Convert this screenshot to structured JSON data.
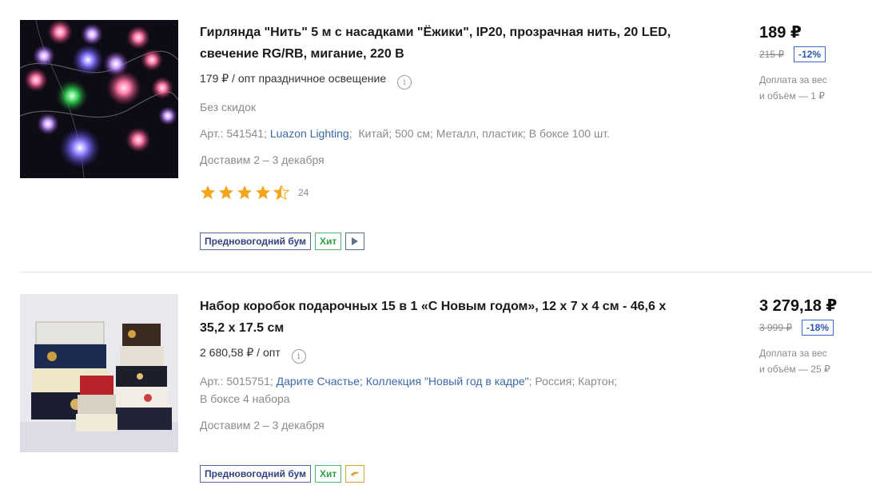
{
  "products": [
    {
      "title_line1": "Гирлянда \"Нить\" 5 м с насадками \"Ёжики\", IP20, прозрачная нить, 20 LED,",
      "title_line2": "свечение RG/RB, мигание, 220 В",
      "wholesale": "179 ₽ / опт праздничное освещение",
      "info_icon": "i",
      "discount_note": "Без скидок",
      "article": "Арт.: 541541;",
      "brand": "Luazon Lighting",
      "specs": "Китай; 500 см; Металл, пластик; В боксе 100 шт.",
      "delivery": "Доставим 2 – 3 декабря",
      "rating": 4.5,
      "rating_count": "24",
      "badges": [
        "Предновогодний бум",
        "Хит"
      ],
      "badge_icon": "play-icon",
      "price": "189 ₽",
      "old_price": "215 ₽",
      "discount": "-12%",
      "surcharge_line1": "Доплата за вес",
      "surcharge_line2": "и объём — 1 ₽"
    },
    {
      "title_line1": "Набор коробок подарочных 15 в 1 «С Новым годом», 12 х 7 х 4 см - 46,6 х",
      "title_line2": "35,2 х 17.5 см",
      "wholesale": "2 680,58 ₽ / опт",
      "info_icon": "i",
      "article": "Арт.: 5015751;",
      "brand": "Дарите Счастье;",
      "collection": "Коллекция \"Новый год в кадре\"",
      "specs_line1_rest": "; Россия; Картон;",
      "specs_line2": "В боксе 4 набора",
      "delivery": "Доставим 2 – 3 декабря",
      "badges": [
        "Предновогодний бум",
        "Хит"
      ],
      "badge_icon": "dolphin-icon",
      "price": "3 279,18 ₽",
      "old_price": "3 999 ₽",
      "discount": "-18%",
      "surcharge_line1": "Доплата за вес",
      "surcharge_line2": "и объём — 25 ₽"
    }
  ],
  "colors": {
    "link": "#3b69a8",
    "badge_blue": "#323f82",
    "badge_green": "#2fa043",
    "discount_blue": "#2d57ac",
    "star": "#f4a51c"
  }
}
